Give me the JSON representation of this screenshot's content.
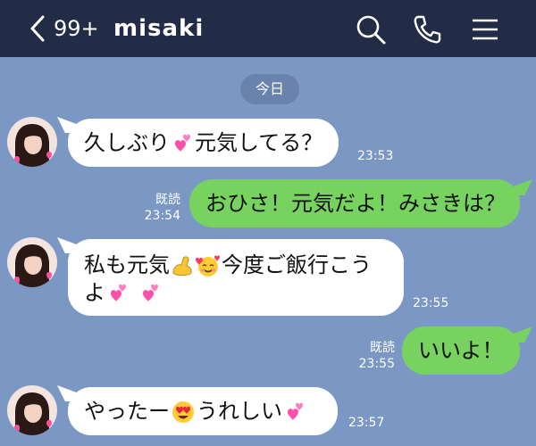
{
  "header": {
    "unread_count": "99+",
    "contact_name": "misaki"
  },
  "date_label": "今日",
  "messages": [
    {
      "id": "m1",
      "sender": "incoming",
      "parts": [
        "久しぶり",
        "元気してる？"
      ],
      "emojis": [
        "two-hearts"
      ],
      "time": "23:53"
    },
    {
      "id": "m2",
      "sender": "outgoing",
      "text": "おひさ！元気だよ！みさきは？",
      "read_label": "既読",
      "time": "23:54"
    },
    {
      "id": "m3",
      "sender": "incoming",
      "parts": [
        "私も元気",
        "今度ご飯行こう",
        "よ"
      ],
      "emojis": [
        "flexed-biceps",
        "smiling-face-with-hearts",
        "two-hearts",
        "two-hearts"
      ],
      "time": "23:55"
    },
    {
      "id": "m4",
      "sender": "outgoing",
      "text": "いいよ！",
      "read_label": "既読",
      "time": "23:55"
    },
    {
      "id": "m5",
      "sender": "incoming",
      "parts": [
        "やったー",
        "うれしい"
      ],
      "emojis": [
        "heart-eyes-face",
        "two-hearts"
      ],
      "time": "23:57"
    }
  ],
  "colors": {
    "background": "#7b97c4",
    "header": "#222c46",
    "outgoing_bubble": "#77d25f",
    "incoming_bubble": "#ffffff"
  }
}
